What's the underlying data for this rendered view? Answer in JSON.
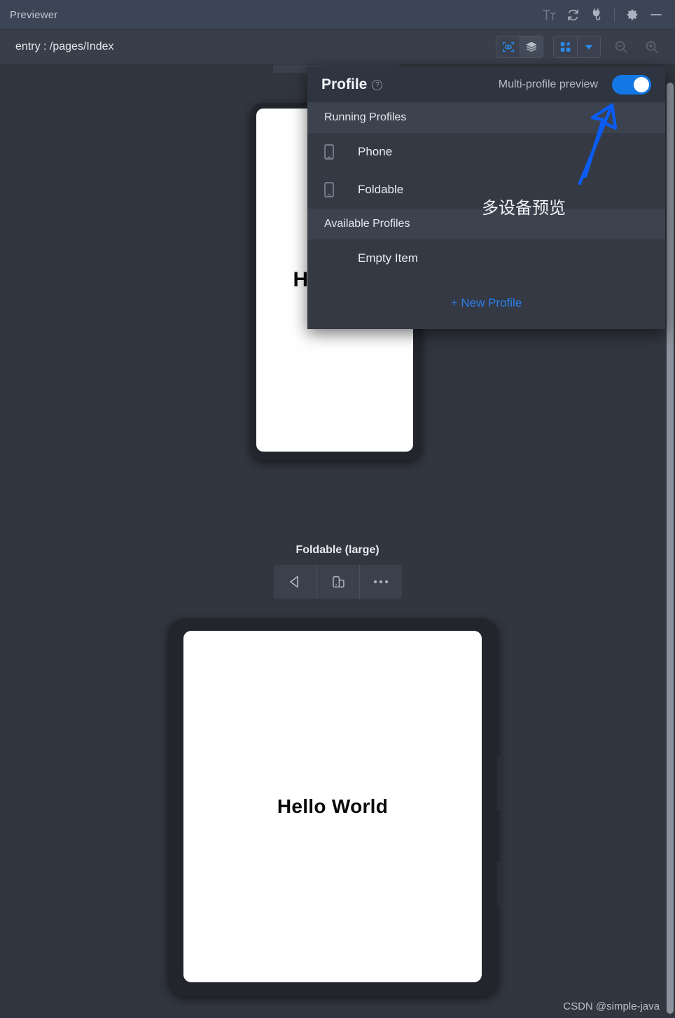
{
  "window": {
    "title": "Previewer",
    "actions": [
      {
        "name": "font-size-icon",
        "label": "Tт"
      },
      {
        "name": "refresh-icon",
        "label": ""
      },
      {
        "name": "plug-icon",
        "label": ""
      },
      {
        "name": "settings-gear-icon",
        "label": ""
      },
      {
        "name": "minimize-icon",
        "label": ""
      }
    ]
  },
  "entry_bar": {
    "label": "entry : /pages/Index",
    "inspector_button": "inspector-icon",
    "layers_button": "layers-icon",
    "multi_device_button": "multi-device-grid-icon",
    "dropdown_button": "chevron-down-icon",
    "zoom_out_button": "zoom-out-icon",
    "zoom_in_button": "zoom-in-icon"
  },
  "profile_panel": {
    "title": "Profile",
    "help_icon_label": "?",
    "multi_profile_label": "Multi-profile preview",
    "toggle_on": true,
    "toggle_color": "#1478e4",
    "sections": [
      {
        "header": "Running Profiles",
        "items": [
          {
            "label": "Phone",
            "icon": "phone-device-icon"
          },
          {
            "label": "Foldable",
            "icon": "phone-device-icon"
          }
        ]
      },
      {
        "header": "Available Profiles",
        "items": [
          {
            "label": "Empty Item",
            "icon": ""
          }
        ]
      }
    ],
    "new_profile_label": "+ New Profile",
    "new_profile_color": "#2a7fe8"
  },
  "devices": [
    {
      "title": "",
      "screen_text": "He",
      "screen_text_full": "Hello World",
      "toolbar": []
    },
    {
      "title": "Foldable (large)",
      "screen_text": "Hello World",
      "toolbar": [
        {
          "name": "rotate-back-icon",
          "label": ""
        },
        {
          "name": "fold-unfold-icon",
          "label": ""
        },
        {
          "name": "more-options-icon",
          "label": ""
        }
      ]
    }
  ],
  "annotations": {
    "chinese_note": "多设备预览",
    "arrow_color": "#0b5cf5"
  },
  "watermark": "CSDN @simple-java"
}
